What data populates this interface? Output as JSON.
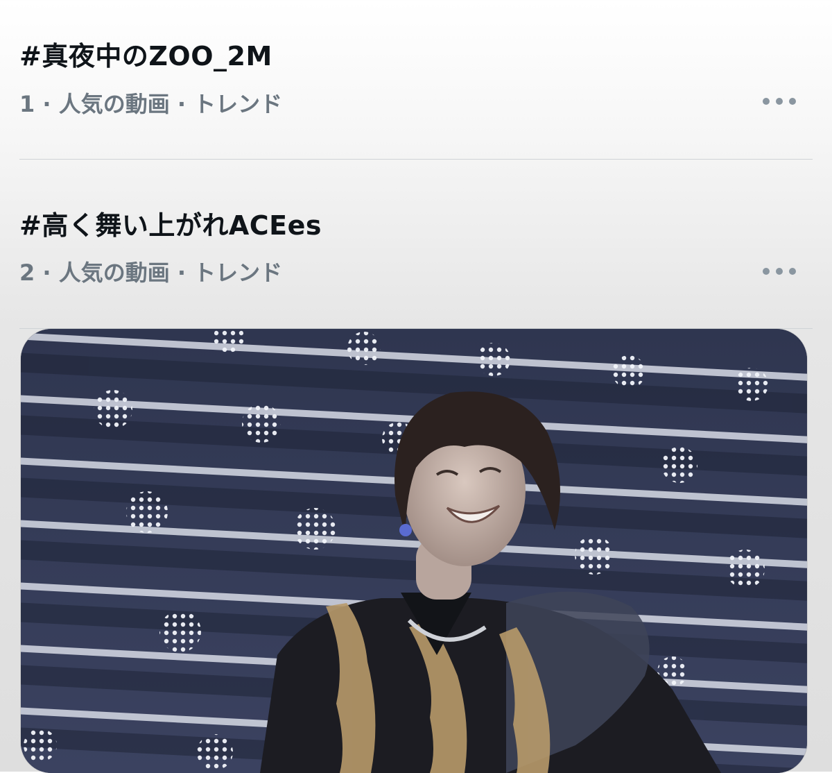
{
  "trends": [
    {
      "title": "#真夜中のZOO_2M",
      "meta": "1 · 人気の動画 · トレンド"
    },
    {
      "title": "#高く舞い上がれACEes",
      "meta": "2 · 人気の動画 · トレンド"
    }
  ],
  "video": {
    "subject": "performer-on-stage",
    "colors": {
      "stage_stripe": "#3d4560",
      "stage_light": "#e9edf5",
      "jacket": "#1c1c20",
      "embroidery": "#b89a6a"
    }
  },
  "icons": {
    "more": "more-horizontal-icon"
  }
}
